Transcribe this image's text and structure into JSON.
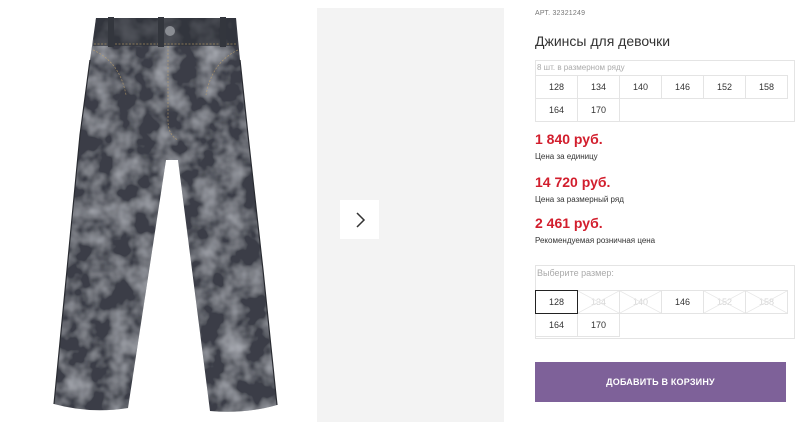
{
  "product": {
    "sku_prefix": "АРТ.",
    "sku": "32321249",
    "title": "Джинсы для девочки"
  },
  "size_set": {
    "label": "8 шт. в размерном ряду",
    "sizes": [
      "128",
      "134",
      "140",
      "146",
      "152",
      "158",
      "164",
      "170"
    ]
  },
  "prices": {
    "unit_price": "1 840 руб.",
    "unit_label": "Цена за единицу",
    "set_price": "14 720 руб.",
    "set_label": "Цена за размерный ряд",
    "retail_price": "2 461 руб.",
    "retail_label": "Рекомендуемая розничная цена"
  },
  "size_picker": {
    "label": "Выберите размер:",
    "options": [
      {
        "label": "128",
        "state": "selected"
      },
      {
        "label": "134",
        "state": "disabled"
      },
      {
        "label": "140",
        "state": "disabled"
      },
      {
        "label": "146",
        "state": "available"
      },
      {
        "label": "152",
        "state": "disabled"
      },
      {
        "label": "158",
        "state": "disabled"
      },
      {
        "label": "164",
        "state": "available"
      },
      {
        "label": "170",
        "state": "available"
      }
    ]
  },
  "actions": {
    "add_to_cart": "ДОБАВИТЬ В КОРЗИНУ"
  },
  "gallery": {
    "next_icon": "chevron-right-icon",
    "image": "jeans-photo"
  },
  "colors": {
    "price": "#d21e2d",
    "button": "#7e6199",
    "denim": "#3a3d45"
  }
}
